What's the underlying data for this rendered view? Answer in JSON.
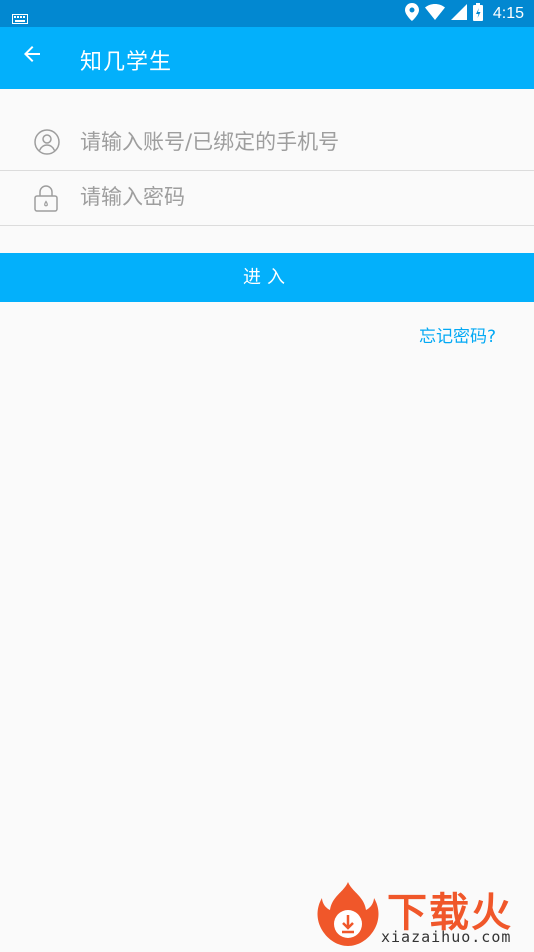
{
  "status_bar": {
    "time": "4:15",
    "icons": [
      "keyboard-icon",
      "location-icon",
      "wifi-icon",
      "signal-icon",
      "battery-icon"
    ]
  },
  "app_bar": {
    "back_icon": "arrow-left-icon",
    "title": "知几学生"
  },
  "form": {
    "account": {
      "placeholder": "请输入账号/已绑定的手机号",
      "value": "",
      "icon": "user-circle-icon"
    },
    "password": {
      "placeholder": "请输入密码",
      "value": "",
      "icon": "lock-icon"
    },
    "login_label": "进入",
    "forgot_label": "忘记密码?"
  },
  "watermark": {
    "brand": "下载火",
    "domain": "xiazaihuo.com"
  },
  "colors": {
    "primary": "#03b0fb",
    "status_bar": "#0288d1",
    "link": "#03a9f4",
    "background": "#fafafa"
  }
}
